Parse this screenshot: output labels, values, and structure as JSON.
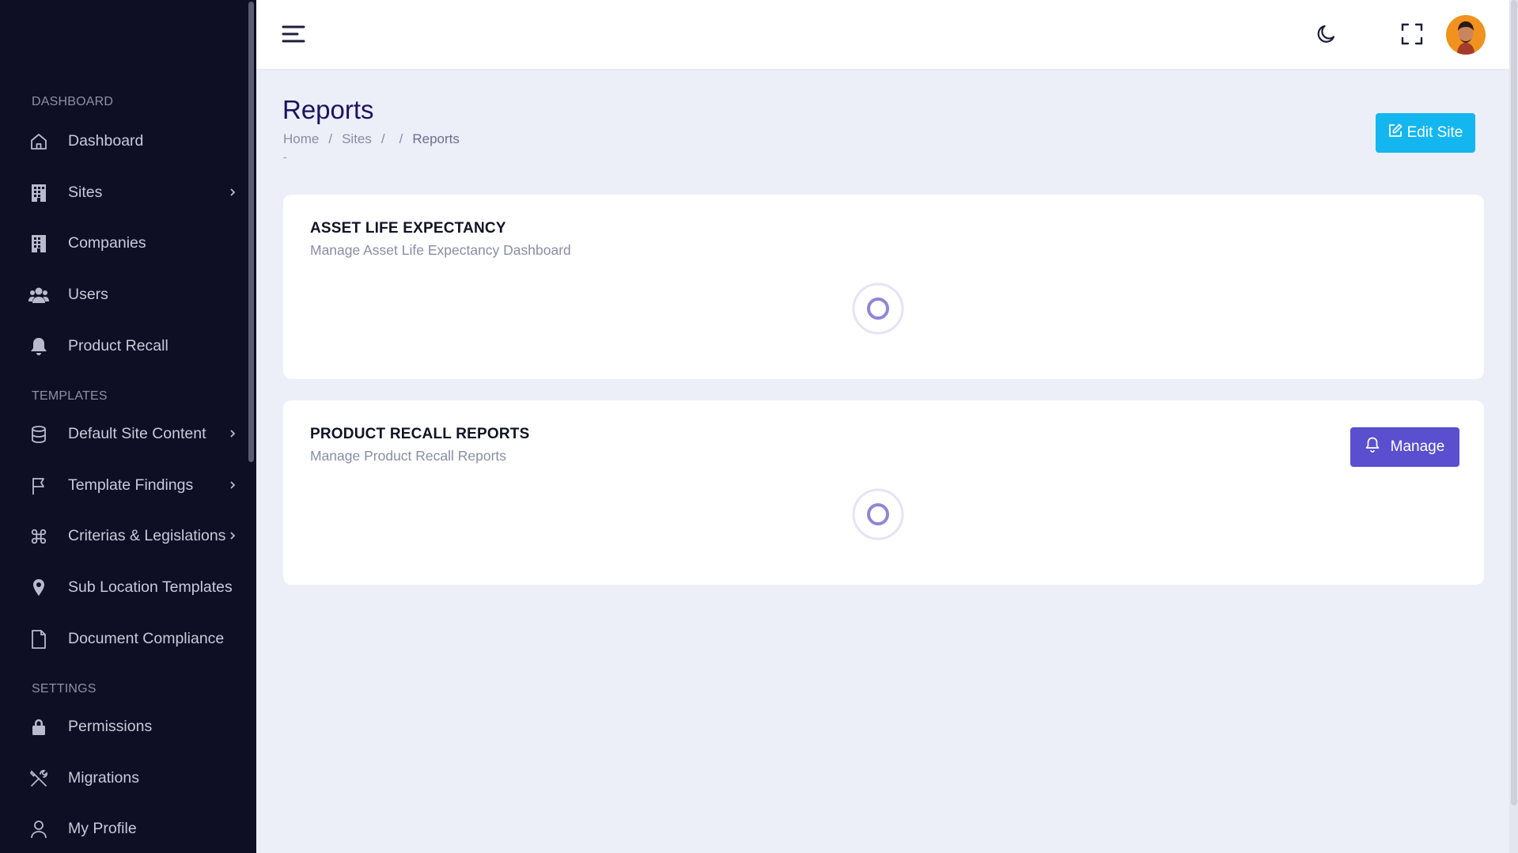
{
  "sidebar": {
    "sections": {
      "dashboard": "DASHBOARD",
      "templates": "TEMPLATES",
      "settings": "SETTINGS"
    },
    "items": {
      "dashboard": "Dashboard",
      "sites": "Sites",
      "companies": "Companies",
      "users": "Users",
      "product_recall": "Product Recall",
      "default_site_content": "Default Site Content",
      "template_findings": "Template Findings",
      "criterias": "Criterias & Legislations",
      "sub_location_templates": "Sub Location Templates",
      "document_compliance": "Document Compliance",
      "permissions": "Permissions",
      "migrations": "Migrations",
      "my_profile": "My Profile"
    }
  },
  "header": {
    "icons": [
      "menu-icon",
      "moon-icon",
      "fullscreen-icon",
      "avatar"
    ]
  },
  "page": {
    "title": "Reports",
    "breadcrumb": {
      "home": "Home",
      "sites": "Sites",
      "current": "Reports",
      "sep": "/",
      "extra": "-"
    },
    "edit_button": "Edit Site"
  },
  "cards": {
    "asset": {
      "title": "ASSET LIFE EXPECTANCY",
      "subtitle": "Manage Asset Life Expectancy Dashboard"
    },
    "recall": {
      "title": "PRODUCT RECALL REPORTS",
      "subtitle": "Manage Product Recall Reports",
      "button": "Manage"
    }
  },
  "colors": {
    "sidebar_bg": "#0e0f25",
    "accent_purple": "#5a4fcf",
    "accent_cyan": "#14b6ef",
    "title_navy": "#1a1360"
  }
}
